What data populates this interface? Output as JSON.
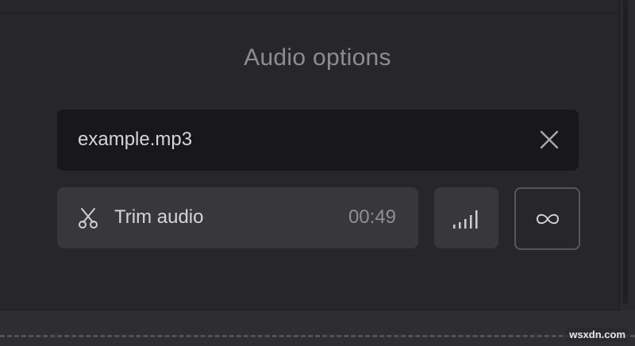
{
  "panel": {
    "title": "Audio options"
  },
  "file": {
    "name": "example.mp3",
    "clear_icon": "close-icon"
  },
  "trim": {
    "icon": "scissors-icon",
    "label": "Trim audio",
    "duration": "00:49"
  },
  "volume": {
    "icon": "volume-bars-icon"
  },
  "loop": {
    "icon": "infinity-icon"
  },
  "watermark": "wsxdn.com",
  "colors": {
    "panel_bg": "#27272a",
    "field_bg": "#18181b",
    "button_bg": "#38383c",
    "text_primary": "#d5d5d8",
    "text_muted": "#8c8c92",
    "loop_border": "#56565c"
  }
}
